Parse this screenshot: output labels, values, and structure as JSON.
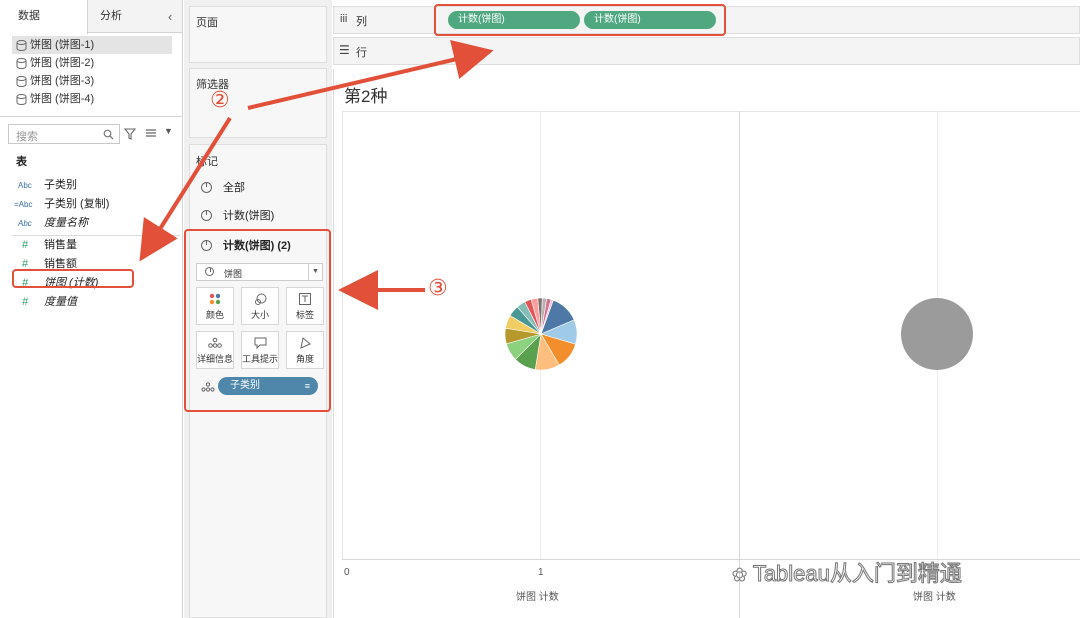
{
  "left_pane": {
    "tabs": [
      "数据",
      "分析"
    ],
    "collapse_icon": "chevron-left-icon",
    "datasources": [
      "饼图 (饼图-1)",
      "饼图 (饼图-2)",
      "饼图 (饼图-3)",
      "饼图 (饼图-4)"
    ],
    "search_placeholder": "搜索",
    "section_label": "表",
    "dimensions": [
      {
        "type": "Abc",
        "label": "子类别"
      },
      {
        "type": "=Abc",
        "label": "子类别 (复制)"
      },
      {
        "type": "Abc",
        "label": "度量名称"
      }
    ],
    "measures": [
      {
        "type": "#",
        "label": "销售量"
      },
      {
        "type": "#",
        "label": "销售额"
      },
      {
        "type": "#",
        "label": "饼图 (计数)"
      },
      {
        "type": "#",
        "label": "度量值"
      }
    ]
  },
  "shelves": {
    "pages_label": "页面",
    "filters_label": "筛选器",
    "marks_label": "标记",
    "columns_label": "列",
    "rows_label": "行",
    "column_pills": [
      "计数(饼图)",
      "计数(饼图)"
    ]
  },
  "marks_card": {
    "rows": [
      "全部",
      "计数(饼图)",
      "计数(饼图) (2)"
    ],
    "mark_type": "饼图",
    "buttons": [
      "颜色",
      "大小",
      "标签",
      "详细信息",
      "工具提示",
      "角度"
    ],
    "detail_pill": "子类别"
  },
  "annotations": [
    "②",
    "③"
  ],
  "view": {
    "title": "第2种",
    "x_ticks": [
      "0",
      "1"
    ],
    "axis_title_left": "饼图 计数",
    "axis_title_right": "饼图 计数",
    "watermark": "Tableau从入门到精通"
  },
  "colors": {
    "pill_green": "#4fa880",
    "pill_blue": "#4e87a9",
    "annotation_red": "#e2503a",
    "gray_circle": "#9b9b9b"
  },
  "chart_data": {
    "type": "pie",
    "title": "第2种",
    "slice_colors": [
      "#4e79a7",
      "#a0cbe8",
      "#f28e2b",
      "#ffbe7d",
      "#59a14f",
      "#8cd17d",
      "#b6992d",
      "#f1ce63",
      "#499894",
      "#86bcb6",
      "#e15759",
      "#ff9d9a",
      "#79706e",
      "#bab0ac",
      "#d37295",
      "#fabfd2"
    ],
    "slice_values": [
      13,
      11,
      12,
      11,
      10,
      8,
      7,
      6,
      5,
      4,
      3,
      3,
      2,
      2,
      2,
      1
    ]
  }
}
